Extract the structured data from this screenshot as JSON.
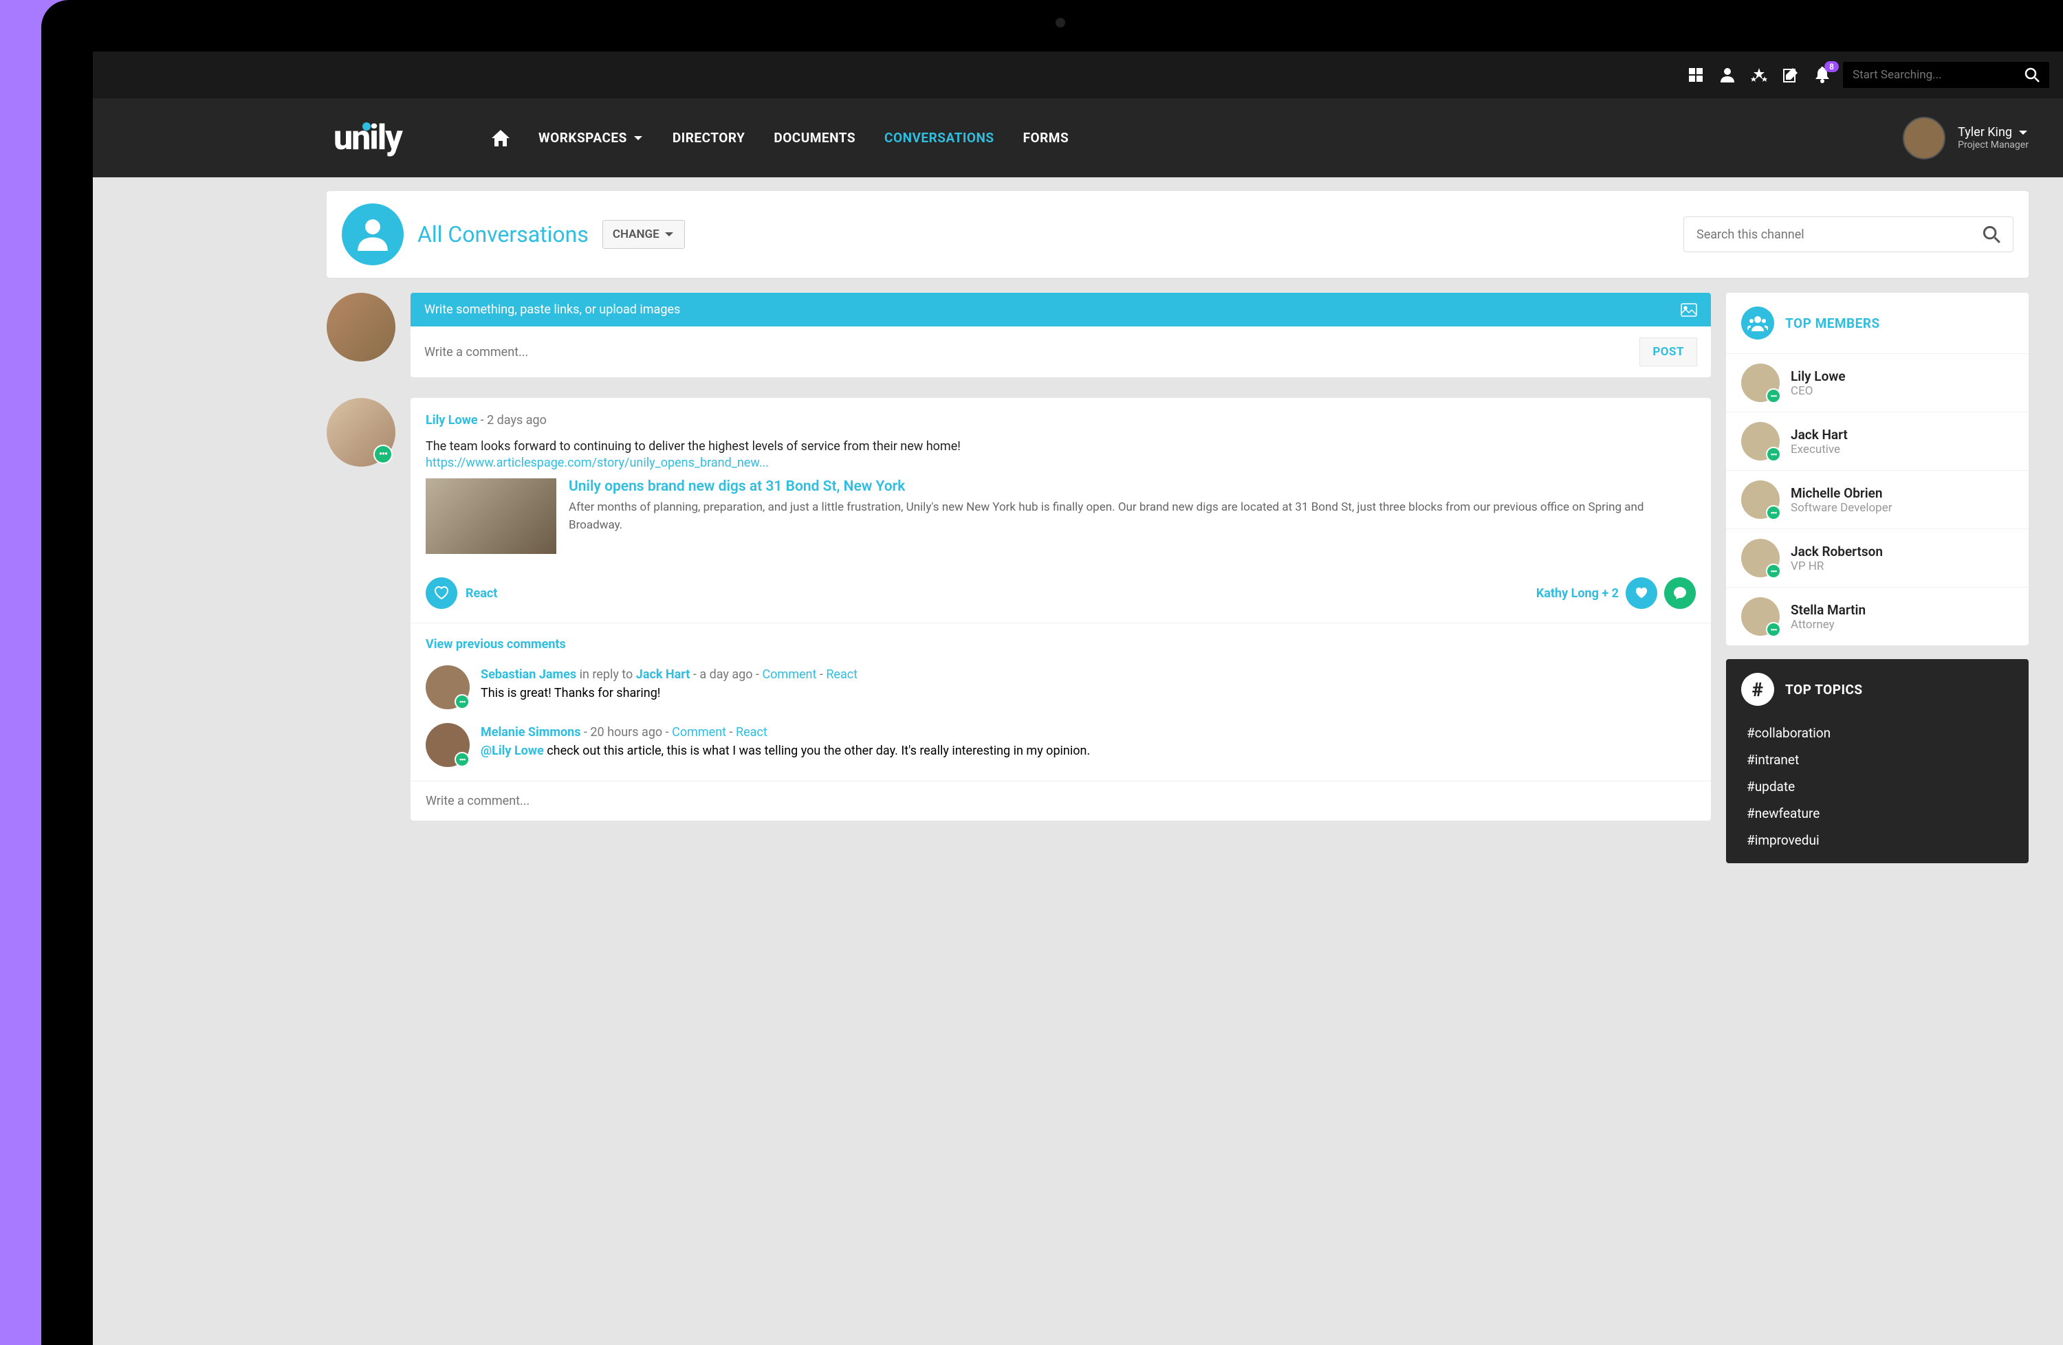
{
  "topbar": {
    "notification_count": "8",
    "search_placeholder": "Start Searching..."
  },
  "nav": {
    "logo": "unily",
    "items": [
      "WORKSPACES",
      "DIRECTORY",
      "DOCUMENTS",
      "CONVERSATIONS",
      "FORMS"
    ],
    "active_index": 3
  },
  "user": {
    "name": "Tyler King",
    "role": "Project Manager"
  },
  "channel": {
    "title": "All Conversations",
    "change_label": "CHANGE",
    "search_placeholder": "Search this channel"
  },
  "composer": {
    "hint": "Write something, paste links, or upload images",
    "placeholder": "Write a comment...",
    "post_label": "POST"
  },
  "post": {
    "author": "Lily Lowe",
    "time": "2 days ago",
    "body": "The team looks forward to continuing to deliver the highest levels of service from their new home!",
    "link": "https://www.articlespage.com/story/unily_opens_brand_new...",
    "preview_title": "Unily opens brand new digs at 31 Bond St, New York",
    "preview_desc": "After months of planning, preparation, and just a little frustration, Unily's new New York hub is finally open. Our brand new digs are located at 31 Bond St, just three blocks from our previous office on Spring and Broadway.",
    "react_label": "React",
    "reactors": "Kathy Long + 2",
    "view_prev": "View previous comments",
    "comment_placeholder": "Write a comment...",
    "comments": [
      {
        "name": "Sebastian James",
        "reply_prefix": "in reply to",
        "reply_to": "Jack Hart",
        "time": "a day ago",
        "action1": "Comment",
        "action2": "React",
        "text": "This is great! Thanks for sharing!"
      },
      {
        "name": "Melanie Simmons",
        "time": "20 hours ago",
        "action1": "Comment",
        "action2": "React",
        "mention": "@Lily Lowe",
        "text": "check out this article, this is what I was telling you the other day. It's really interesting in my opinion."
      }
    ]
  },
  "top_members": {
    "title": "TOP MEMBERS",
    "list": [
      {
        "name": "Lily Lowe",
        "role": "CEO"
      },
      {
        "name": "Jack Hart",
        "role": "Executive"
      },
      {
        "name": "Michelle Obrien",
        "role": "Software Developer"
      },
      {
        "name": "Jack Robertson",
        "role": "VP HR"
      },
      {
        "name": "Stella Martin",
        "role": "Attorney"
      }
    ]
  },
  "top_topics": {
    "title": "TOP TOPICS",
    "list": [
      "#collaboration",
      "#intranet",
      "#update",
      "#newfeature",
      "#improvedui"
    ]
  }
}
